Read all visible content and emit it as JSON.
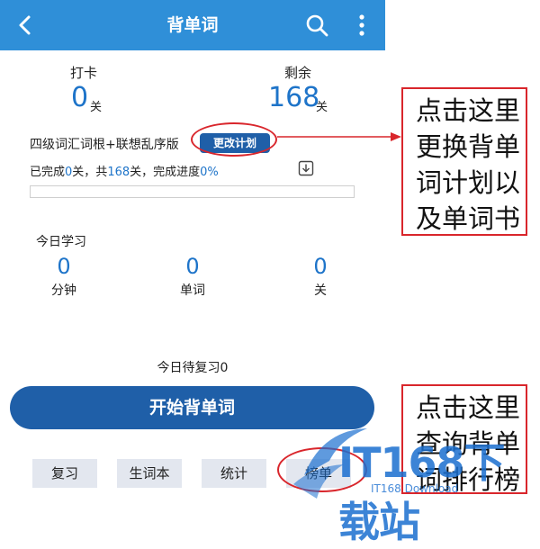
{
  "header": {
    "title": "背单词"
  },
  "stats": {
    "checkin": {
      "label": "打卡",
      "value": "0",
      "unit": "关"
    },
    "remaining": {
      "label": "剩余",
      "value": "168",
      "unit": "关"
    }
  },
  "plan": {
    "name": "四级词汇词根+联想乱序版",
    "change_button": "更改计划",
    "progress": {
      "prefix": "已完成",
      "done": "0",
      "mid": "关，共",
      "total": "168",
      "suffix": "关，完成进度",
      "percent": "0%"
    },
    "progress_fraction": 0
  },
  "today": {
    "title": "今日学习",
    "items": [
      {
        "value": "0",
        "unit": "分钟"
      },
      {
        "value": "0",
        "unit": "单词"
      },
      {
        "value": "0",
        "unit": "关"
      }
    ]
  },
  "review_today": "今日待复习0",
  "start_button": "开始背单词",
  "bottom_buttons": [
    "复习",
    "生词本",
    "统计",
    "榜单"
  ],
  "callouts": {
    "first": [
      "点击这里",
      "更换背单",
      "词计划以",
      "及单词书"
    ],
    "second": [
      "点击这里",
      "查询背单",
      "词排行榜"
    ]
  },
  "watermark": {
    "brand": "IT168下载站",
    "sub": "IT168 Download"
  },
  "colors": {
    "header": "#2f8fd8",
    "primary": "#1f5fa8",
    "accent_number": "#1e74c9",
    "annotation": "#d9262c"
  }
}
